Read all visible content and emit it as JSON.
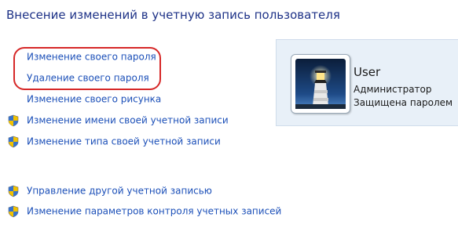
{
  "page": {
    "title": "Внесение изменений в учетную запись пользователя"
  },
  "tasks": [
    {
      "label": "Изменение своего пароля",
      "icon": ""
    },
    {
      "label": "Удаление своего пароля",
      "icon": ""
    },
    {
      "label": "Изменение своего рисунка",
      "icon": ""
    },
    {
      "label": "Изменение имени своей учетной записи",
      "icon": "uac-shield-icon"
    },
    {
      "label": "Изменение типа своей учетной записи",
      "icon": "uac-shield-icon"
    },
    {
      "label": "Управление другой учетной записью",
      "icon": "uac-shield-icon"
    },
    {
      "label": "Изменение параметров контроля учетных записей",
      "icon": "uac-shield-icon"
    }
  ],
  "user": {
    "name": "User",
    "role": "Администратор",
    "status": "Защищена паролем",
    "avatar_icon": "lighthouse-picture"
  },
  "colors": {
    "heading": "#1e3287",
    "link": "#1b4fb8",
    "highlight": "#d62828",
    "card_background": "#e8f0f8"
  }
}
